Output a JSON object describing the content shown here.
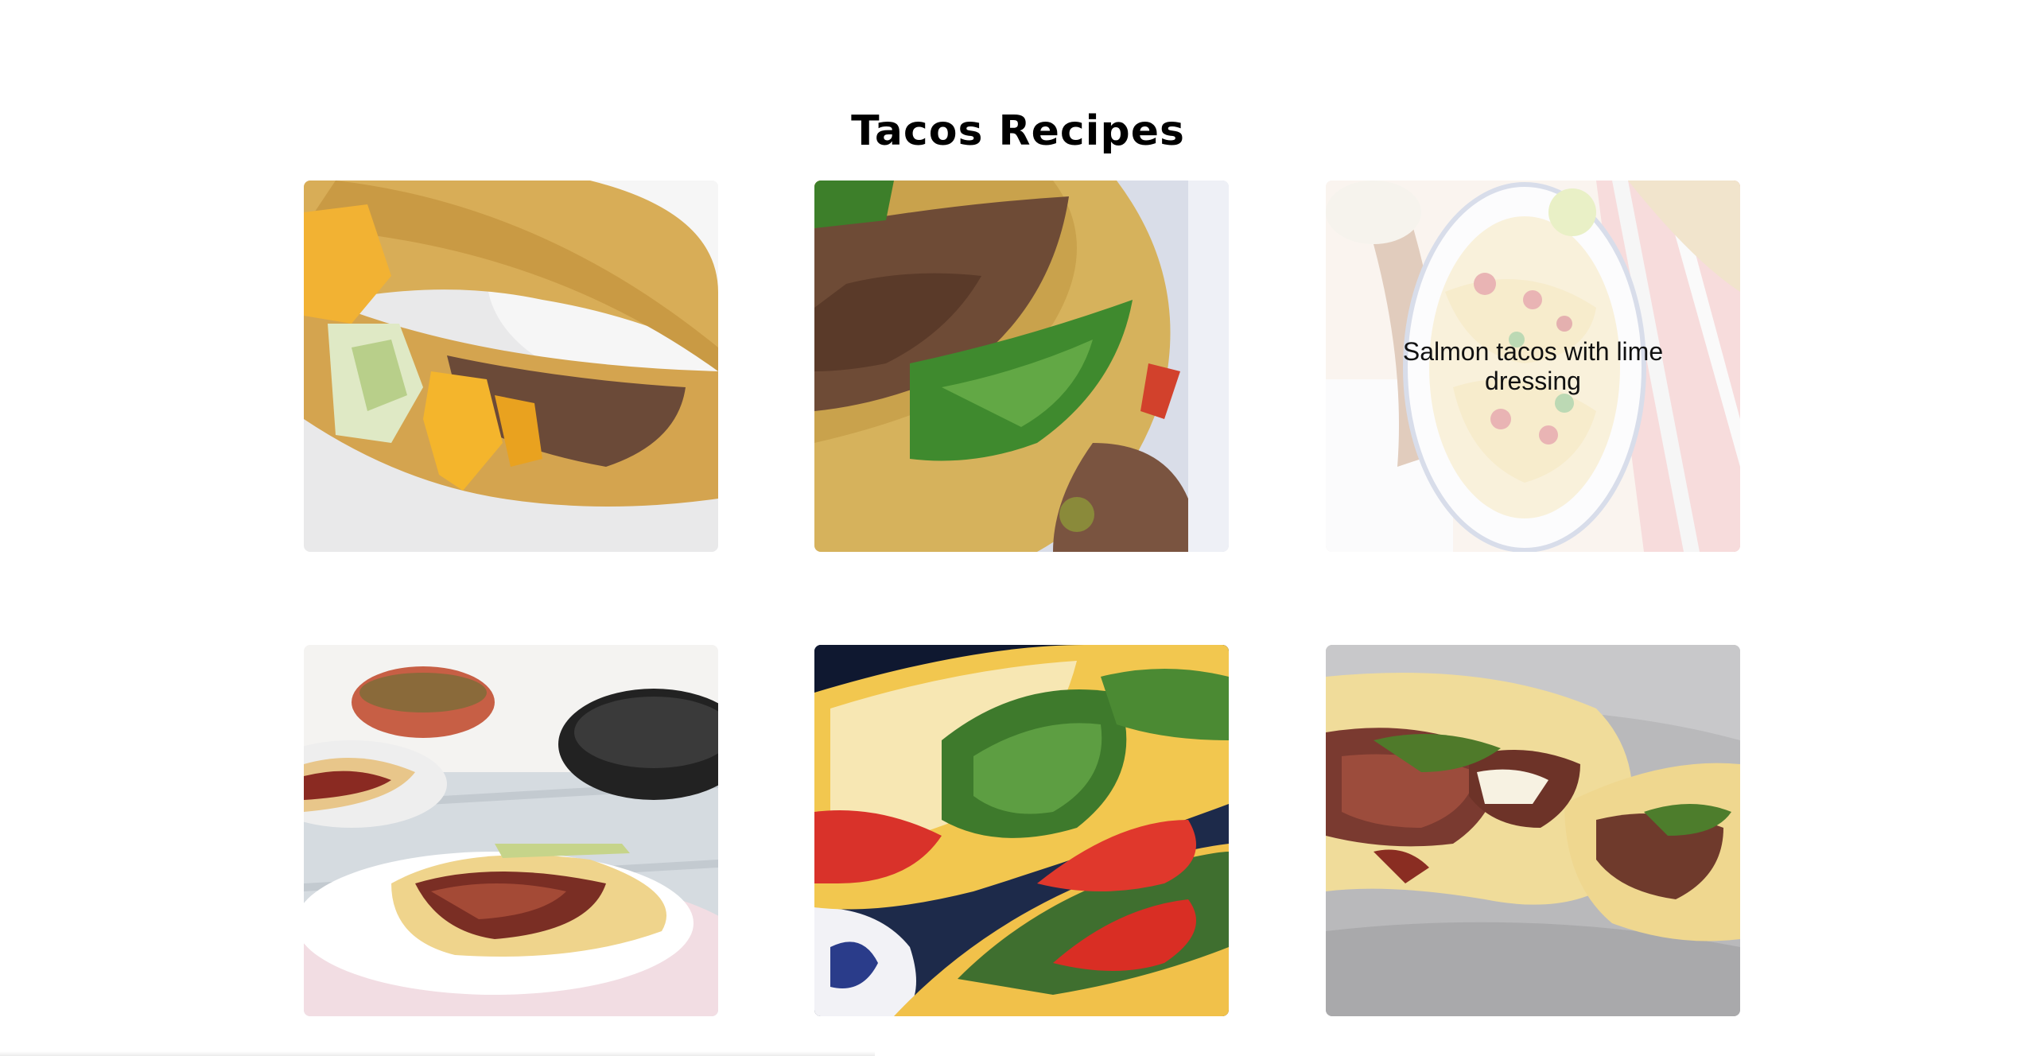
{
  "page": {
    "title": "Tacos Recipes"
  },
  "recipes": [
    {
      "caption": "",
      "image_icon": "crispy-beef-taco-photo",
      "hovered": false
    },
    {
      "caption": "",
      "image_icon": "ground-beef-tacos-photo",
      "hovered": false
    },
    {
      "caption": "Salmon tacos with lime dressing",
      "image_icon": "salmon-tacos-photo",
      "hovered": true
    },
    {
      "caption": "",
      "image_icon": "pulled-pork-tacos-photo",
      "hovered": false
    },
    {
      "caption": "",
      "image_icon": "lettuce-tomato-tacos-photo",
      "hovered": false
    },
    {
      "caption": "",
      "image_icon": "steak-tacos-photo",
      "hovered": false
    }
  ],
  "colors": {
    "background": "#ffffff",
    "title": "#000000",
    "tortilla": "#d9b25a",
    "beef": "#6b4a38",
    "cheese": "#f2b233",
    "lettuce": "#3f8a2e"
  }
}
